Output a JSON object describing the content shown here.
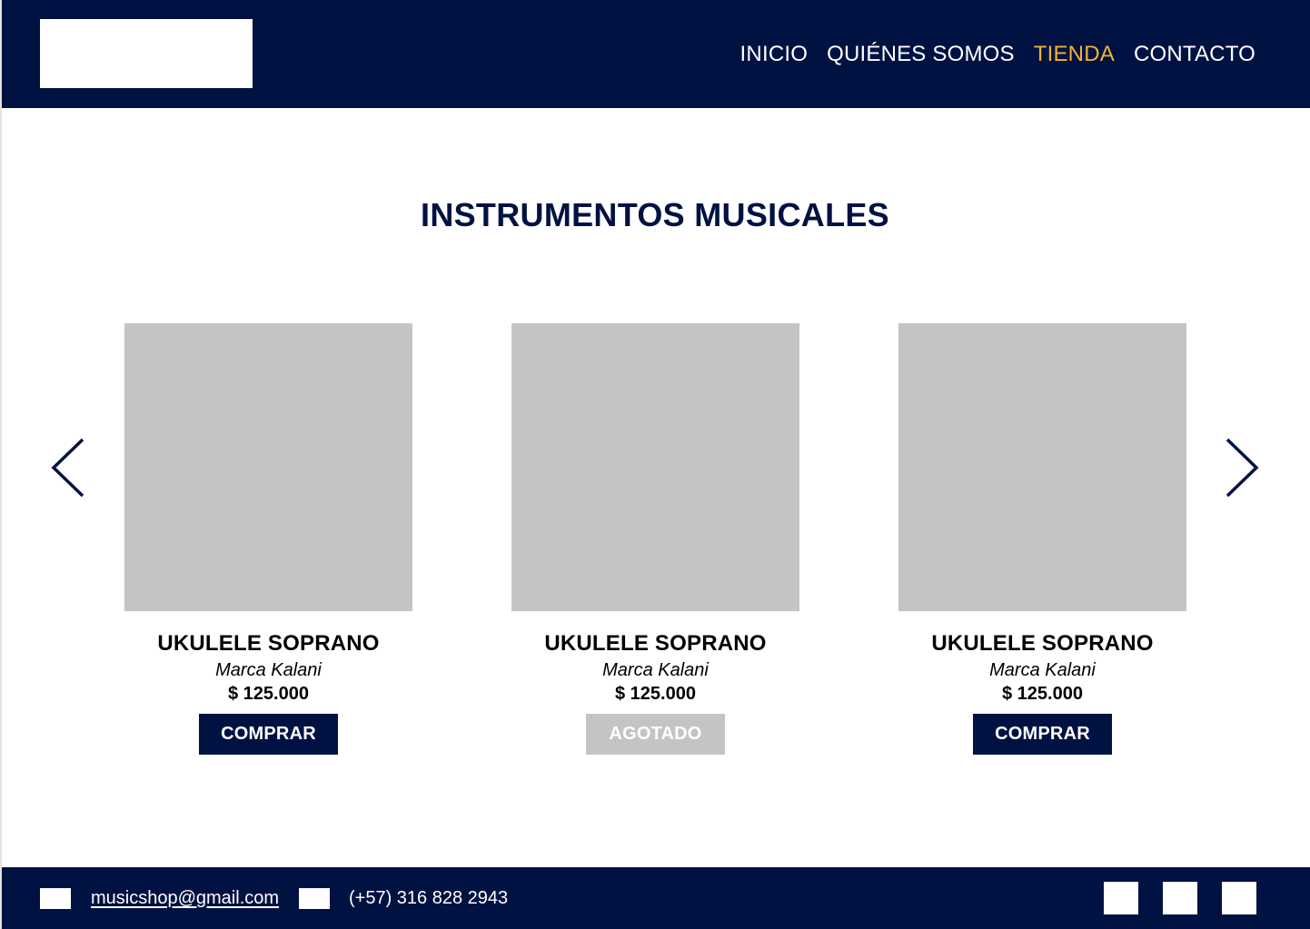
{
  "header": {
    "nav": [
      {
        "label": "INICIO",
        "active": false
      },
      {
        "label": "QUIÉNES SOMOS",
        "active": false
      },
      {
        "label": "TIENDA",
        "active": true
      },
      {
        "label": "CONTACTO",
        "active": false
      }
    ]
  },
  "main": {
    "title": "INSTRUMENTOS MUSICALES",
    "products": [
      {
        "name": "UKULELE SOPRANO",
        "brand": "Marca Kalani",
        "price": "$ 125.000",
        "button": "COMPRAR",
        "available": true
      },
      {
        "name": "UKULELE SOPRANO",
        "brand": "Marca Kalani",
        "price": "$ 125.000",
        "button": "AGOTADO",
        "available": false
      },
      {
        "name": "UKULELE SOPRANO",
        "brand": "Marca Kalani",
        "price": "$ 125.000",
        "button": "COMPRAR",
        "available": true
      }
    ],
    "carousel": {
      "prev_icon": "chevron-left-icon",
      "next_icon": "chevron-right-icon"
    }
  },
  "footer": {
    "email": "musicshop@gmail.com",
    "phone": "(+57) 316 828 2943",
    "icons": [
      "email-icon",
      "phone-icon"
    ],
    "social_icons": [
      "social-icon-1",
      "social-icon-2",
      "social-icon-3"
    ]
  },
  "colors": {
    "primary": "#001242",
    "accent": "#f2b134",
    "placeholder": "#c4c4c4",
    "background": "#ffffff"
  }
}
